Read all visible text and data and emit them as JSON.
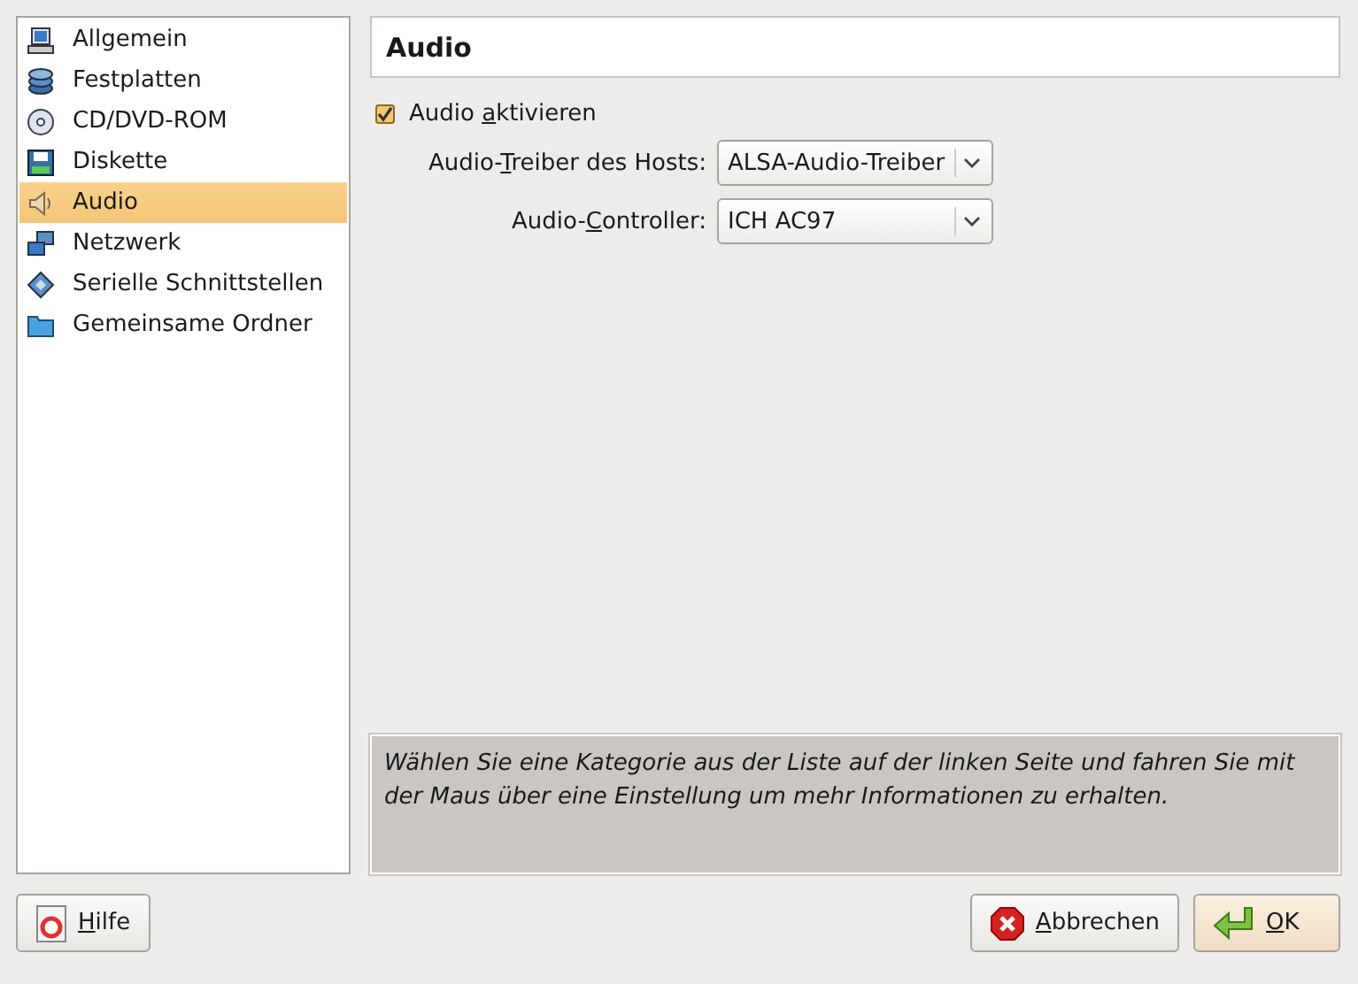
{
  "sidebar": {
    "items": [
      {
        "label": "Allgemein",
        "kind": "computer",
        "selected": false
      },
      {
        "label": "Festplatten",
        "kind": "disk",
        "selected": false
      },
      {
        "label": "CD/DVD-ROM",
        "kind": "cd",
        "selected": false
      },
      {
        "label": "Diskette",
        "kind": "floppy",
        "selected": false
      },
      {
        "label": "Audio",
        "kind": "speaker",
        "selected": true
      },
      {
        "label": "Netzwerk",
        "kind": "network",
        "selected": false
      },
      {
        "label": "Serielle Schnittstellen",
        "kind": "serial",
        "selected": false
      },
      {
        "label": "Gemeinsame Ordner",
        "kind": "folder",
        "selected": false
      }
    ]
  },
  "page": {
    "title": "Audio",
    "enable_audio": {
      "label": {
        "before": "Audio ",
        "key": "a",
        "after": "ktivieren"
      },
      "checked": true
    },
    "fields": [
      {
        "label": {
          "before": "Audio-",
          "key": "T",
          "after": "reiber des Hosts:"
        },
        "value": "ALSA-Audio-Treiber"
      },
      {
        "label": {
          "before": "Audio-",
          "key": "C",
          "after": "ontroller:"
        },
        "value": "ICH AC97"
      }
    ],
    "info": "Wählen Sie eine Kategorie aus der Liste auf der linken Seite und fahren Sie mit der Maus über eine Einstellung um mehr Informationen zu erhalten."
  },
  "buttons": [
    {
      "kind": "help",
      "label": {
        "key": "H",
        "after": "ilfe"
      }
    },
    {
      "kind": "cancel",
      "label": {
        "key": "A",
        "after": "bbrechen"
      }
    },
    {
      "kind": "ok",
      "label": {
        "key": "O",
        "after": "K"
      }
    }
  ]
}
